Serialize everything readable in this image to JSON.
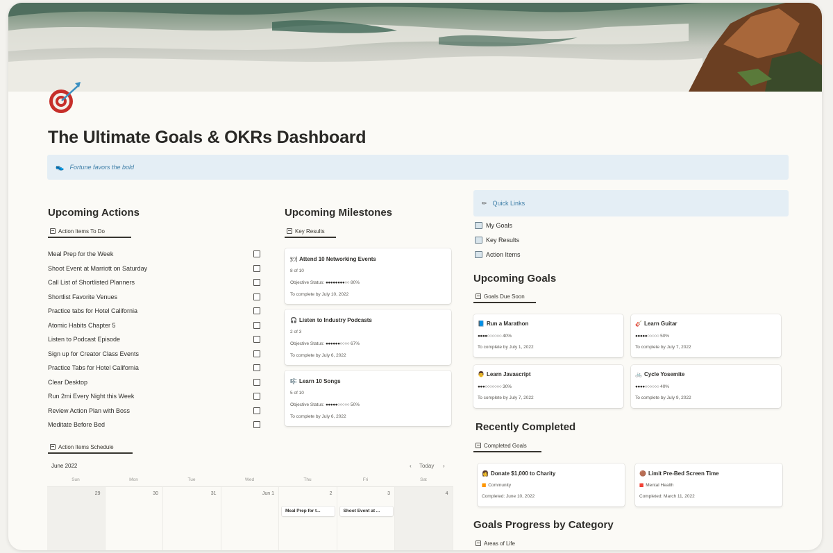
{
  "page": {
    "title": "The Ultimate Goals & OKRs Dashboard",
    "quote_icon": "shoe-icon",
    "quote": "Fortune favors the bold"
  },
  "actions": {
    "heading": "Upcoming Actions",
    "view_label": "Action Items To Do",
    "items": [
      "Meal Prep for the Week",
      "Shoot Event at Marriott on Saturday",
      "Call List of Shortlisted Planners",
      "Shortlist Favorite Venues",
      "Practice tabs for Hotel California",
      "Atomic Habits Chapter 5",
      "Listen to Podcast Episode",
      "Sign up for Creator Class Events",
      "Practice Tabs for Hotel California",
      "Clear Desktop",
      "Run 2mi Every Night this Week",
      "Review Action Plan with Boss",
      "Meditate Before Bed"
    ]
  },
  "schedule": {
    "view_label": "Action Items Schedule",
    "month": "June 2022",
    "today": "Today",
    "prev": "‹",
    "next": "›",
    "weekdays": [
      "Sun",
      "Mon",
      "Tue",
      "Wed",
      "Thu",
      "Fri",
      "Sat"
    ],
    "days": [
      "29",
      "30",
      "31",
      "Jun 1",
      "2",
      "3",
      "4"
    ],
    "events": [
      "Meal Prep for t...",
      "Shoot Event at ..."
    ]
  },
  "milestones": {
    "heading": "Upcoming Milestones",
    "view_label": "Key Results",
    "cards": [
      {
        "icon": "🍽",
        "title": "Attend 10 Networking Events",
        "count": "8 of 10",
        "status_label": "Objective Status:",
        "bar": "●●●●●●●●○○",
        "pct": "80%",
        "due": "To complete by July 10, 2022"
      },
      {
        "icon": "🎧",
        "title": "Listen to Industry Podcasts",
        "count": "2 of 3",
        "status_label": "Objective Status:",
        "bar": "●●●●●●○○○○",
        "pct": "67%",
        "due": "To complete by July 6, 2022"
      },
      {
        "icon": "🎼",
        "title": "Learn 10 Songs",
        "count": "5 of 10",
        "status_label": "Objective Status:",
        "bar": "●●●●●○○○○○",
        "pct": "50%",
        "due": "To complete by July 6, 2022"
      }
    ]
  },
  "quick_links": {
    "heading": "Quick Links",
    "links": [
      "My Goals",
      "Key Results",
      "Action Items"
    ]
  },
  "goals": {
    "heading": "Upcoming Goals",
    "view_label": "Goals Due Soon",
    "cards": [
      {
        "icon": "📘",
        "title": "Run a Marathon",
        "bar": "●●●●○○○○○○",
        "pct": "40%",
        "due": "To complete by July 1, 2022"
      },
      {
        "icon": "🎸",
        "title": "Learn Guitar",
        "bar": "●●●●●○○○○○",
        "pct": "50%",
        "due": "To complete by July 7, 2022"
      },
      {
        "icon": "👨",
        "title": "Learn Javascript",
        "bar": "●●●○○○○○○○",
        "pct": "30%",
        "due": "To complete by July 7, 2022"
      },
      {
        "icon": "🚲",
        "title": "Cycle Yosemite",
        "bar": "●●●●○○○○○○",
        "pct": "40%",
        "due": "To complete by July 9, 2022"
      }
    ]
  },
  "completed": {
    "heading": "Recently Completed",
    "view_label": "Completed Goals",
    "cards": [
      {
        "icon": "👩",
        "title": "Donate $1,000 to Charity",
        "tag_icon": "🟧",
        "tag": "Community",
        "date": "Completed: June 10, 2022"
      },
      {
        "icon": "🟤",
        "title": "Limit Pre-Bed Screen Time",
        "tag_icon": "🟥",
        "tag": "Mental Health",
        "date": "Completed: March 11, 2022"
      }
    ]
  },
  "progress": {
    "heading": "Goals Progress by Category",
    "view_label": "Areas of Life"
  },
  "colors": {
    "callout_bg": "#e4eef5",
    "callout_text": "#3f7fa8",
    "page_bg": "#fbfaf6"
  }
}
